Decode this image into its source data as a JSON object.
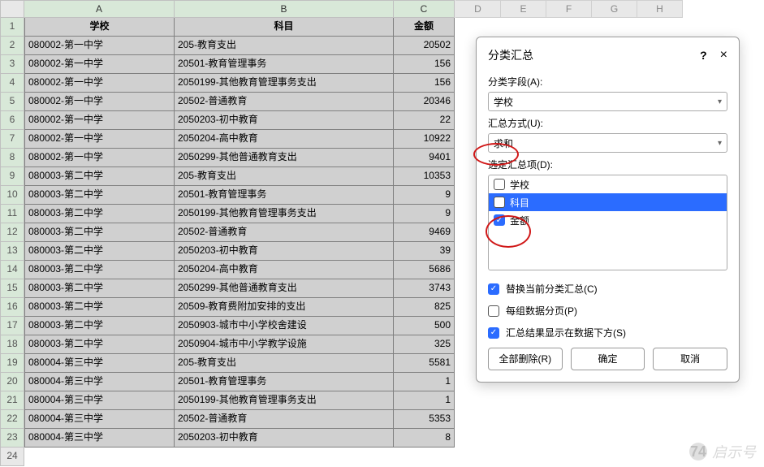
{
  "columns": {
    "A": "A",
    "B": "B",
    "C": "C",
    "D": "D",
    "E": "E",
    "F": "F",
    "G": "G",
    "H": "H"
  },
  "headers": {
    "school": "学校",
    "subject": "科目",
    "amount": "金额"
  },
  "rows": [
    {
      "n": 1,
      "a": "学校",
      "b": "科目",
      "c": "金额",
      "hdr": true
    },
    {
      "n": 2,
      "a": "080002-第一中学",
      "b": "205-教育支出",
      "c": "20502"
    },
    {
      "n": 3,
      "a": "080002-第一中学",
      "b": "20501-教育管理事务",
      "c": "156"
    },
    {
      "n": 4,
      "a": "080002-第一中学",
      "b": "2050199-其他教育管理事务支出",
      "c": "156"
    },
    {
      "n": 5,
      "a": "080002-第一中学",
      "b": "20502-普通教育",
      "c": "20346"
    },
    {
      "n": 6,
      "a": "080002-第一中学",
      "b": "2050203-初中教育",
      "c": "22"
    },
    {
      "n": 7,
      "a": "080002-第一中学",
      "b": "2050204-高中教育",
      "c": "10922"
    },
    {
      "n": 8,
      "a": "080002-第一中学",
      "b": "2050299-其他普通教育支出",
      "c": "9401"
    },
    {
      "n": 9,
      "a": "080003-第二中学",
      "b": "205-教育支出",
      "c": "10353"
    },
    {
      "n": 10,
      "a": "080003-第二中学",
      "b": "20501-教育管理事务",
      "c": "9"
    },
    {
      "n": 11,
      "a": "080003-第二中学",
      "b": "2050199-其他教育管理事务支出",
      "c": "9"
    },
    {
      "n": 12,
      "a": "080003-第二中学",
      "b": "20502-普通教育",
      "c": "9469"
    },
    {
      "n": 13,
      "a": "080003-第二中学",
      "b": "2050203-初中教育",
      "c": "39"
    },
    {
      "n": 14,
      "a": "080003-第二中学",
      "b": "2050204-高中教育",
      "c": "5686"
    },
    {
      "n": 15,
      "a": "080003-第二中学",
      "b": "2050299-其他普通教育支出",
      "c": "3743"
    },
    {
      "n": 16,
      "a": "080003-第二中学",
      "b": "20509-教育费附加安排的支出",
      "c": "825"
    },
    {
      "n": 17,
      "a": "080003-第二中学",
      "b": "2050903-城市中小学校舍建设",
      "c": "500"
    },
    {
      "n": 18,
      "a": "080003-第二中学",
      "b": "2050904-城市中小学教学设施",
      "c": "325"
    },
    {
      "n": 19,
      "a": "080004-第三中学",
      "b": "205-教育支出",
      "c": "5581"
    },
    {
      "n": 20,
      "a": "080004-第三中学",
      "b": "20501-教育管理事务",
      "c": "1"
    },
    {
      "n": 21,
      "a": "080004-第三中学",
      "b": "2050199-其他教育管理事务支出",
      "c": "1"
    },
    {
      "n": 22,
      "a": "080004-第三中学",
      "b": "20502-普通教育",
      "c": "5353"
    },
    {
      "n": 23,
      "a": "080004-第三中学",
      "b": "2050203-初中教育",
      "c": "8"
    }
  ],
  "emptyRow": "24",
  "dialog": {
    "title": "分类汇总",
    "help": "?",
    "close": "×",
    "groupByLabel": "分类字段(A):",
    "groupByValue": "学校",
    "funcLabel": "汇总方式(U):",
    "funcValue": "求和",
    "itemsLabel": "选定汇总项(D):",
    "items": [
      {
        "label": "学校",
        "checked": false,
        "selected": false
      },
      {
        "label": "科目",
        "checked": false,
        "selected": true
      },
      {
        "label": "金额",
        "checked": true,
        "selected": false
      }
    ],
    "opt1": "替换当前分类汇总(C)",
    "opt1checked": true,
    "opt2": "每组数据分页(P)",
    "opt2checked": false,
    "opt3": "汇总结果显示在数据下方(S)",
    "opt3checked": true,
    "btnRemove": "全部删除(R)",
    "btnOk": "确定",
    "btnCancel": "取消"
  },
  "watermark": {
    "badge": "74",
    "text": "启示号"
  }
}
